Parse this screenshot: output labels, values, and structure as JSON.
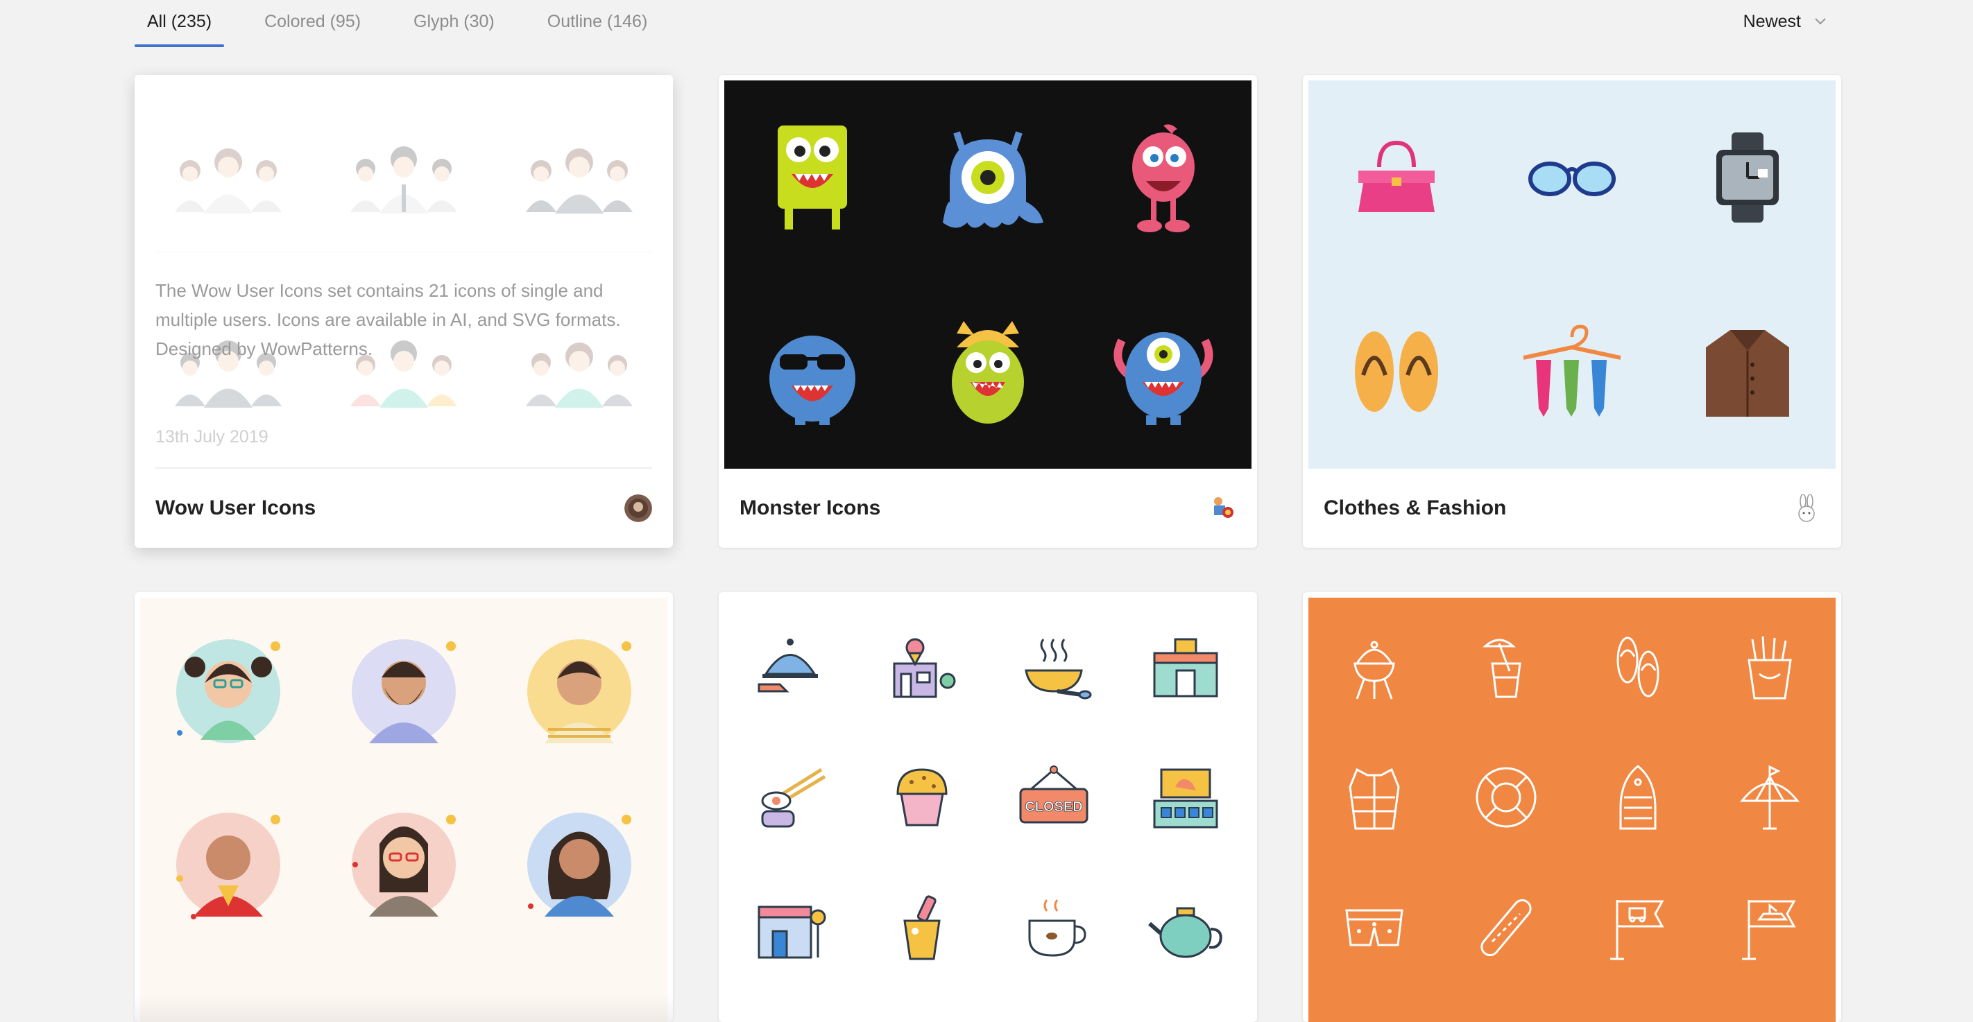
{
  "filter": {
    "tabs": [
      {
        "label": "All (235)",
        "active": true
      },
      {
        "label": "Colored (95)",
        "active": false
      },
      {
        "label": "Glyph (30)",
        "active": false
      },
      {
        "label": "Outline (146)",
        "active": false
      }
    ],
    "sort_label": "Newest"
  },
  "cards": [
    {
      "title": "Wow User Icons",
      "description": "The Wow User Icons set contains 21 icons of single and multiple users. Icons are available in AI, and SVG formats. Designed by WowPatterns.",
      "date": "13th July 2019",
      "preview_bg": "#ffffff"
    },
    {
      "title": "Monster Icons",
      "preview_bg": "#111111"
    },
    {
      "title": "Clothes & Fashion",
      "preview_bg": "#e2eff6"
    },
    {
      "title": "",
      "preview_bg": "#fdf8f2"
    },
    {
      "title": "",
      "preview_bg": "#ffffff"
    },
    {
      "title": "",
      "preview_bg": "#f08742"
    }
  ],
  "colors": {
    "accent": "#3f72c9",
    "tab_inactive": "#8c8c8c",
    "closed_sign_text": "CLOSED"
  }
}
